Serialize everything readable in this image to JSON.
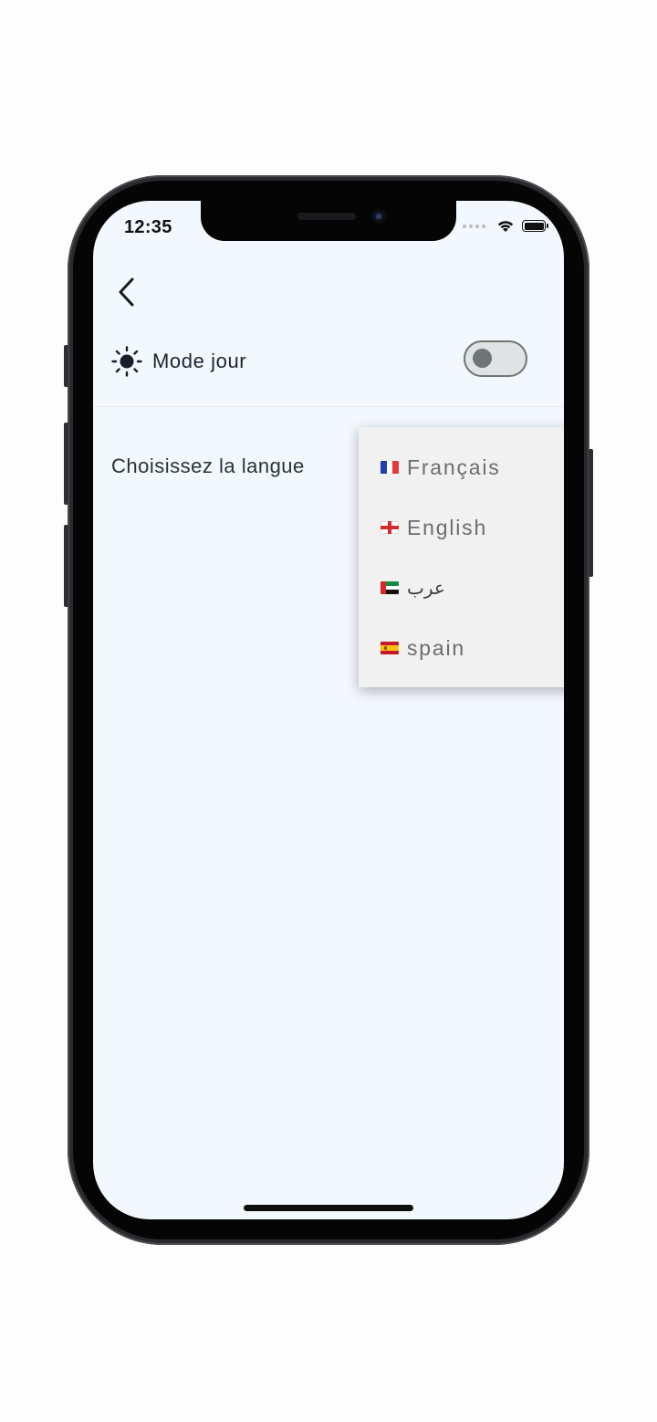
{
  "status_bar": {
    "time": "12:35"
  },
  "settings": {
    "mode_label": "Mode jour",
    "mode_toggle_on": false,
    "language_label": "Choisissez la langue"
  },
  "language_dropdown": {
    "items": [
      {
        "label": "Français",
        "flag": "france-flag"
      },
      {
        "label": "English",
        "flag": "england-flag"
      },
      {
        "label": "عرب",
        "flag": "uae-flag"
      },
      {
        "label": "spain",
        "flag": "spain-flag"
      }
    ]
  },
  "colors": {
    "screen_background": "#f3f7fe",
    "text_primary": "#1c2430",
    "toggle_off": "#6e7575",
    "dropdown_background": "#f1f1f1"
  }
}
